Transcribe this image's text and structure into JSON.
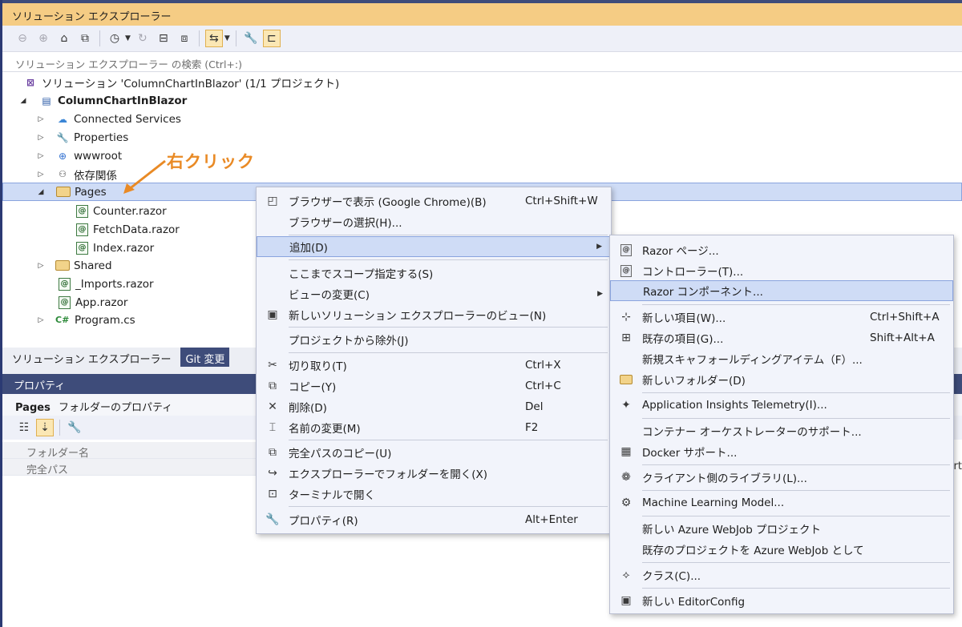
{
  "window": {
    "title": "ソリューション エクスプローラー"
  },
  "search": {
    "placeholder": "ソリューション エクスプローラー の検索 (Ctrl+:)"
  },
  "tree": {
    "solution": "ソリューション 'ColumnChartInBlazor' (1/1 プロジェクト)",
    "project": "ColumnChartInBlazor",
    "items": [
      {
        "label": "Connected Services",
        "icon": "connected-services-icon"
      },
      {
        "label": "Properties",
        "icon": "properties-wrench-icon"
      },
      {
        "label": "wwwroot",
        "icon": "globe-icon"
      },
      {
        "label": "依存関係",
        "icon": "dependencies-icon"
      },
      {
        "label": "Pages",
        "icon": "folder-icon"
      },
      {
        "label": "Counter.razor",
        "icon": "razor-file-icon"
      },
      {
        "label": "FetchData.razor",
        "icon": "razor-file-icon"
      },
      {
        "label": "Index.razor",
        "icon": "razor-file-icon"
      },
      {
        "label": "Shared",
        "icon": "folder-icon"
      },
      {
        "label": "_Imports.razor",
        "icon": "razor-file-icon"
      },
      {
        "label": "App.razor",
        "icon": "razor-file-icon"
      },
      {
        "label": "Program.cs",
        "icon": "csharp-file-icon"
      }
    ]
  },
  "annotation": {
    "text": "右クリック",
    "color": "#e98a25"
  },
  "bottom_tabs": [
    {
      "label": "ソリューション エクスプローラー"
    },
    {
      "label": "Git 変更"
    }
  ],
  "properties": {
    "header": "プロパティ",
    "subject_name": "Pages",
    "subject_type": "フォルダーのプロパティ",
    "rows": [
      {
        "label": "フォルダー名"
      },
      {
        "label": "完全パス"
      }
    ],
    "right_truncated": "rt"
  },
  "context_menu": {
    "items": [
      {
        "label": "ブラウザーで表示 (Google Chrome)(B)",
        "shortcut": "Ctrl+Shift+W"
      },
      {
        "label": "ブラウザーの選択(H)...",
        "shortcut": ""
      },
      {
        "label": "追加(D)",
        "shortcut": ""
      },
      {
        "label": "ここまでスコープ指定する(S)",
        "shortcut": ""
      },
      {
        "label": "ビューの変更(C)",
        "shortcut": ""
      },
      {
        "label": "新しいソリューション エクスプローラーのビュー(N)",
        "shortcut": ""
      },
      {
        "label": "プロジェクトから除外(J)",
        "shortcut": ""
      },
      {
        "label": "切り取り(T)",
        "shortcut": "Ctrl+X"
      },
      {
        "label": "コピー(Y)",
        "shortcut": "Ctrl+C"
      },
      {
        "label": "削除(D)",
        "shortcut": "Del"
      },
      {
        "label": "名前の変更(M)",
        "shortcut": "F2"
      },
      {
        "label": "完全パスのコピー(U)",
        "shortcut": ""
      },
      {
        "label": "エクスプローラーでフォルダーを開く(X)",
        "shortcut": ""
      },
      {
        "label": "ターミナルで開く",
        "shortcut": ""
      },
      {
        "label": "プロパティ(R)",
        "shortcut": "Alt+Enter"
      }
    ]
  },
  "submenu": {
    "items": [
      {
        "label": "Razor ページ...",
        "shortcut": ""
      },
      {
        "label": "コントローラー(T)...",
        "shortcut": ""
      },
      {
        "label": "Razor コンポーネント...",
        "shortcut": ""
      },
      {
        "label": "新しい項目(W)...",
        "shortcut": "Ctrl+Shift+A"
      },
      {
        "label": "既存の項目(G)...",
        "shortcut": "Shift+Alt+A"
      },
      {
        "label": "新規スキャフォールディングアイテム（F）...",
        "shortcut": ""
      },
      {
        "label": "新しいフォルダー(D)",
        "shortcut": ""
      },
      {
        "label": "Application Insights Telemetry(I)...",
        "shortcut": ""
      },
      {
        "label": "コンテナー オーケストレーターのサポート...",
        "shortcut": ""
      },
      {
        "label": "Docker サポート...",
        "shortcut": ""
      },
      {
        "label": "クライアント側のライブラリ(L)...",
        "shortcut": ""
      },
      {
        "label": "Machine Learning Model...",
        "shortcut": ""
      },
      {
        "label": "新しい Azure WebJob プロジェクト",
        "shortcut": ""
      },
      {
        "label": "既存のプロジェクトを Azure WebJob として",
        "shortcut": ""
      },
      {
        "label": "クラス(C)...",
        "shortcut": ""
      },
      {
        "label": "新しい EditorConfig",
        "shortcut": ""
      }
    ]
  }
}
